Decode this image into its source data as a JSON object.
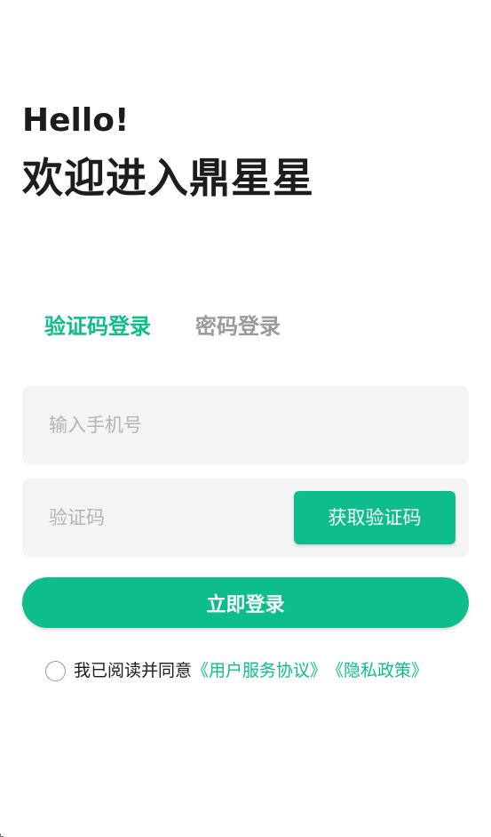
{
  "header": {
    "greeting": "Hello!",
    "title": "欢迎进入鼎星星"
  },
  "tabs": [
    {
      "label": "验证码登录",
      "active": true
    },
    {
      "label": "密码登录",
      "active": false
    }
  ],
  "form": {
    "phone_placeholder": "输入手机号",
    "phone_value": "",
    "code_placeholder": "验证码",
    "code_value": "",
    "get_code_label": "获取验证码",
    "login_label": "立即登录"
  },
  "agreement": {
    "checked": false,
    "text": "我已阅读并同意",
    "user_agreement": "《用户服务协议》",
    "privacy_policy": "《隐私政策》"
  },
  "colors": {
    "accent": "#0dbd8b",
    "inactive_tab": "#9a9a9a",
    "field_bg": "#f4f4f4",
    "placeholder": "#b3b3b3"
  }
}
